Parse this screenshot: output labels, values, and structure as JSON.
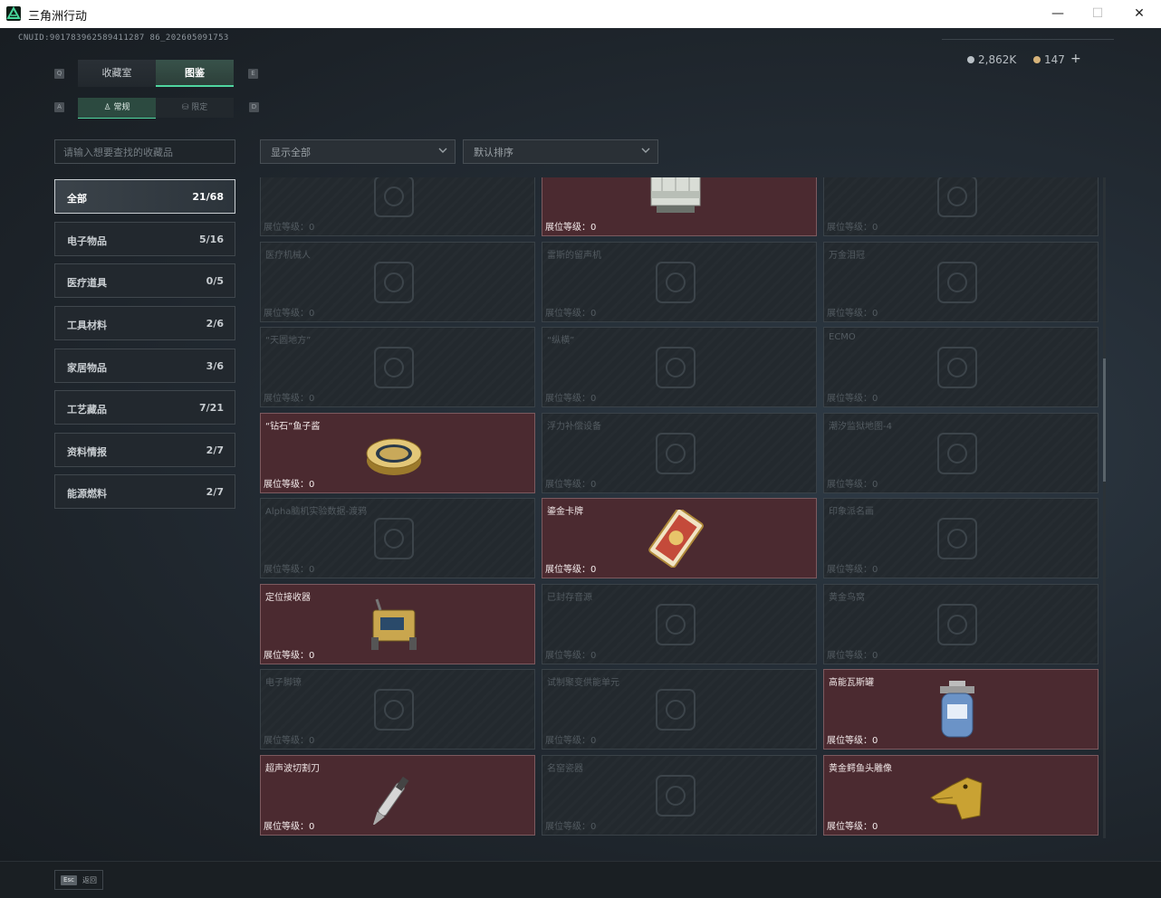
{
  "window": {
    "title": "三角洲行动",
    "minimize": "—",
    "maximize": "☐",
    "close": "✕"
  },
  "header": {
    "uid": "CNUID:901783962589411287 86_202605091753",
    "currency": [
      {
        "value": "2,862K",
        "color": "#b9c0c6"
      },
      {
        "value": "147",
        "color": "#d6b37a"
      }
    ],
    "add_label": "+"
  },
  "tabs": {
    "prev_key": "Q",
    "next_key": "E",
    "items": [
      {
        "label": "收藏室"
      },
      {
        "label": "图鉴"
      }
    ]
  },
  "subtabs": {
    "prev_key": "A",
    "next_key": "D",
    "items": [
      {
        "label": "常规"
      },
      {
        "label": "限定"
      }
    ]
  },
  "search": {
    "placeholder": "请输入想要查找的收藏品"
  },
  "filters": {
    "show": "显示全部",
    "sort": "默认排序"
  },
  "categories": [
    {
      "label": "全部",
      "count": "21/68"
    },
    {
      "label": "电子物品",
      "count": "5/16"
    },
    {
      "label": "医疗道具",
      "count": "0/5"
    },
    {
      "label": "工具材料",
      "count": "2/6"
    },
    {
      "label": "家居物品",
      "count": "3/6"
    },
    {
      "label": "工艺藏品",
      "count": "7/21"
    },
    {
      "label": "资料情报",
      "count": "2/7"
    },
    {
      "label": "能源燃料",
      "count": "2/7"
    }
  ],
  "level_label": "展位等级：0",
  "items": [
    {
      "name": "",
      "owned": false,
      "icon": "robot-icon"
    },
    {
      "name": "",
      "owned": true,
      "icon": "crate-icon"
    },
    {
      "name": "",
      "owned": false,
      "icon": "device-icon"
    },
    {
      "name": "医疗机械人",
      "owned": false,
      "icon": "robot-icon"
    },
    {
      "name": "雷斯的留声机",
      "owned": false,
      "icon": "gramophone-icon"
    },
    {
      "name": "万金泪冠",
      "owned": false,
      "icon": "crown-icon"
    },
    {
      "name": "“天圆地方”",
      "owned": false,
      "icon": "globe-icon"
    },
    {
      "name": "“纵横”",
      "owned": false,
      "icon": "chess-icon"
    },
    {
      "name": "ECMO",
      "owned": false,
      "icon": "machine-icon"
    },
    {
      "name": "“钻石”鱼子酱",
      "owned": true,
      "icon": "caviar-tin-icon"
    },
    {
      "name": "浮力补偿设备",
      "owned": false,
      "icon": "vest-icon"
    },
    {
      "name": "潮汐监狱地图-4",
      "owned": false,
      "icon": "map-icon"
    },
    {
      "name": "Alpha脑机实验数据-渡鸦",
      "owned": false,
      "icon": "drive-icon"
    },
    {
      "name": "鎏金卡牌",
      "owned": true,
      "icon": "card-icon"
    },
    {
      "name": "印象派名画",
      "owned": false,
      "icon": "painting-icon"
    },
    {
      "name": "定位接收器",
      "owned": true,
      "icon": "receiver-icon"
    },
    {
      "name": "已封存音源",
      "owned": false,
      "icon": "record-icon"
    },
    {
      "name": "黄金鸟窝",
      "owned": false,
      "icon": "nest-icon"
    },
    {
      "name": "电子脚镣",
      "owned": false,
      "icon": "anklet-icon"
    },
    {
      "name": "试制聚变供能单元",
      "owned": false,
      "icon": "battery-icon"
    },
    {
      "name": "高能瓦斯罐",
      "owned": true,
      "icon": "gas-canister-icon"
    },
    {
      "name": "超声波切割刀",
      "owned": true,
      "icon": "cutter-icon"
    },
    {
      "name": "名窑瓷器",
      "owned": false,
      "icon": "vase-icon"
    },
    {
      "name": "黄金鳄鱼头雕像",
      "owned": true,
      "icon": "croc-statue-icon"
    }
  ],
  "footer": {
    "key": "Esc",
    "label": "返回"
  }
}
